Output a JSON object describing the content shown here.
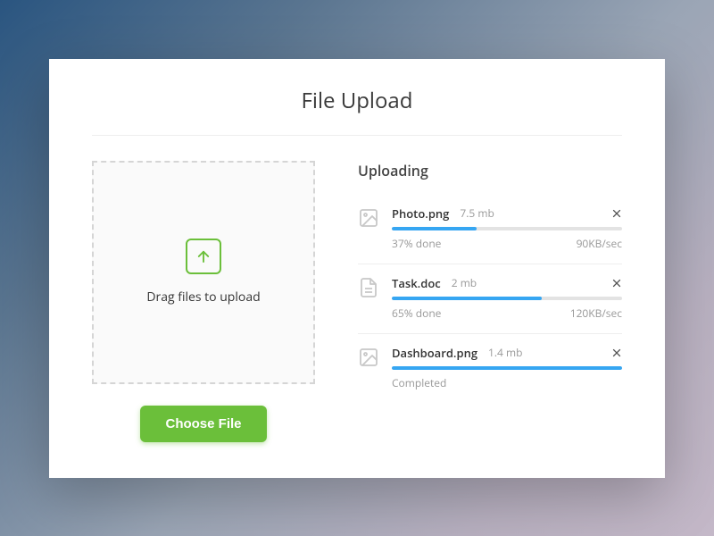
{
  "title": "File Upload",
  "dropzone": {
    "text": "Drag files to upload"
  },
  "choose_button": "Choose File",
  "uploading_heading": "Uploading",
  "colors": {
    "accent_green": "#6bbf3a",
    "progress_blue": "#36a6f2"
  },
  "files": [
    {
      "icon": "image-icon",
      "name": "Photo.png",
      "size": "7.5 mb",
      "progress_pct": 37,
      "status": "37% done",
      "speed": "90KB/sec"
    },
    {
      "icon": "document-icon",
      "name": "Task.doc",
      "size": "2 mb",
      "progress_pct": 65,
      "status": "65% done",
      "speed": "120KB/sec"
    },
    {
      "icon": "image-icon",
      "name": "Dashboard.png",
      "size": "1.4 mb",
      "progress_pct": 100,
      "status": "Completed",
      "speed": ""
    }
  ]
}
